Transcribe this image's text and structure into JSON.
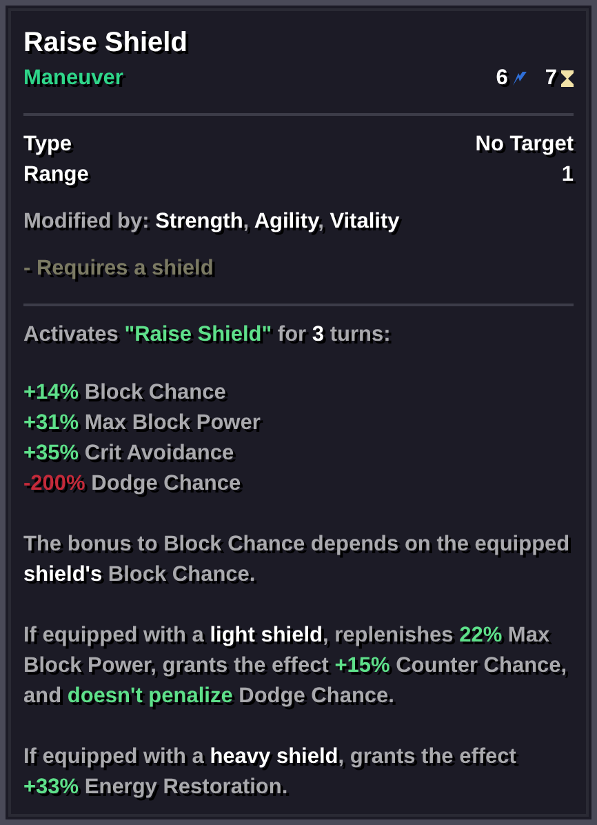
{
  "title": "Raise Shield",
  "category": "Maneuver",
  "costs": [
    {
      "kind": "energy",
      "value": "6"
    },
    {
      "kind": "cooldown",
      "value": "7"
    }
  ],
  "properties": [
    {
      "label": "Type",
      "value": "No Target"
    },
    {
      "label": "Range",
      "value": "1"
    }
  ],
  "modified_by": [
    {
      "text": "Modified by: ",
      "kind": "plain"
    },
    {
      "text": "Strength",
      "kind": "highlight"
    },
    {
      "text": ", ",
      "kind": "plain"
    },
    {
      "text": "Agility",
      "kind": "highlight"
    },
    {
      "text": ", ",
      "kind": "plain"
    },
    {
      "text": "Vitality",
      "kind": "highlight"
    }
  ],
  "requirement": "- Requires a shield",
  "activation": [
    {
      "text": "Activates ",
      "kind": "plain"
    },
    {
      "text": "\"Raise Shield\"",
      "kind": "positive"
    },
    {
      "text": " for ",
      "kind": "plain"
    },
    {
      "text": "3",
      "kind": "highlight"
    },
    {
      "text": " turns:",
      "kind": "plain"
    }
  ],
  "effects": [
    [
      {
        "text": "+14%",
        "kind": "positive"
      },
      {
        "text": " Block Chance",
        "kind": "plain"
      }
    ],
    [
      {
        "text": "+31%",
        "kind": "positive"
      },
      {
        "text": " Max Block Power",
        "kind": "plain"
      }
    ],
    [
      {
        "text": "+35%",
        "kind": "positive"
      },
      {
        "text": " Crit Avoidance",
        "kind": "plain"
      }
    ],
    [
      {
        "text": "-200%",
        "kind": "negative"
      },
      {
        "text": " Dodge Chance",
        "kind": "plain"
      }
    ]
  ],
  "paragraphs": [
    [
      {
        "text": "The bonus to Block Chance depends on the equipped ",
        "kind": "plain"
      },
      {
        "text": "shield's",
        "kind": "highlight"
      },
      {
        "text": " Block Chance.",
        "kind": "plain"
      }
    ],
    [
      {
        "text": "If equipped with a ",
        "kind": "plain"
      },
      {
        "text": "light shield",
        "kind": "highlight"
      },
      {
        "text": ", replenishes ",
        "kind": "plain"
      },
      {
        "text": "22%",
        "kind": "positive"
      },
      {
        "text": " Max Block Power, grants the effect ",
        "kind": "plain"
      },
      {
        "text": "+15%",
        "kind": "positive"
      },
      {
        "text": " Counter Chance, and ",
        "kind": "plain"
      },
      {
        "text": "doesn't penalize",
        "kind": "positive"
      },
      {
        "text": " Dodge Chance.",
        "kind": "plain"
      }
    ],
    [
      {
        "text": "If equipped with a ",
        "kind": "plain"
      },
      {
        "text": "heavy shield",
        "kind": "highlight"
      },
      {
        "text": ", grants the effect ",
        "kind": "plain"
      },
      {
        "text": "+33%",
        "kind": "positive"
      },
      {
        "text": " Energy Restoration.",
        "kind": "plain"
      }
    ]
  ]
}
